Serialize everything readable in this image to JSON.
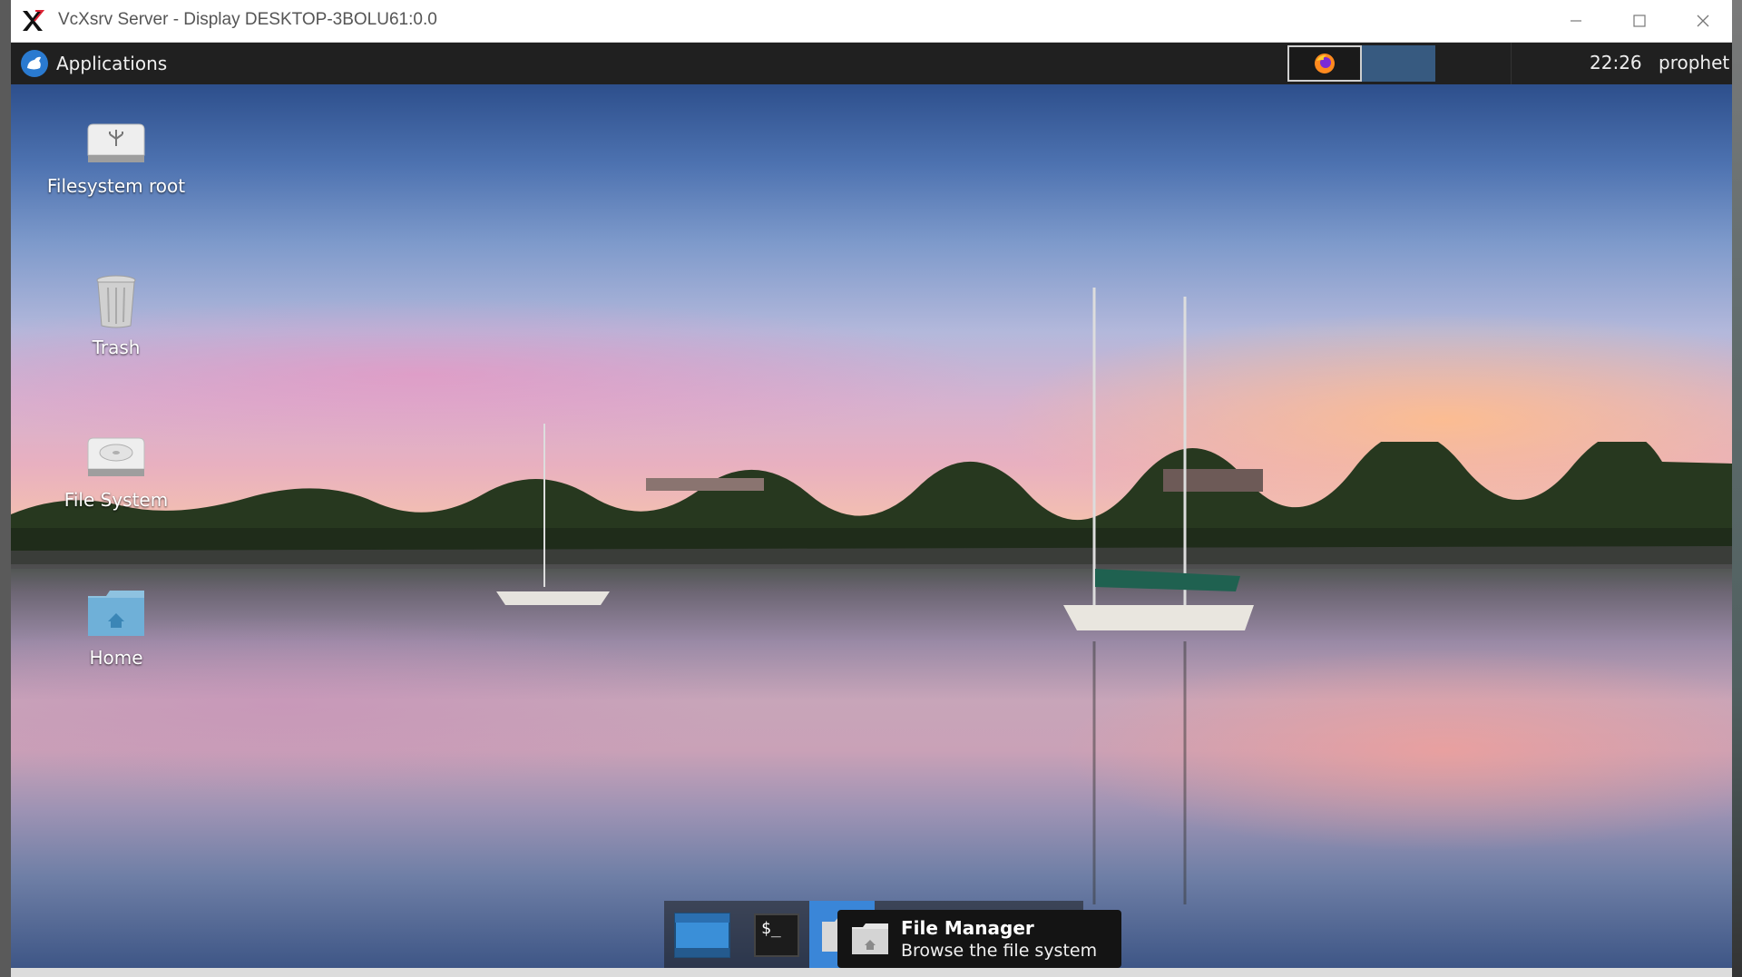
{
  "window": {
    "title": "VcXsrv Server - Display DESKTOP-3BOLU61:0.0"
  },
  "panel": {
    "applications_label": "Applications",
    "clock": "22:26",
    "user": "prophet"
  },
  "desktop": {
    "icons": [
      {
        "label": "Filesystem root",
        "icon": "usb-drive-icon"
      },
      {
        "label": "Trash",
        "icon": "trash-icon"
      },
      {
        "label": "File System",
        "icon": "hard-drive-icon"
      },
      {
        "label": "Home",
        "icon": "home-folder-icon"
      }
    ]
  },
  "dock": {
    "items": [
      "show-desktop-icon",
      "terminal-icon",
      "file-manager-icon"
    ],
    "terminal_glyph": "$_",
    "tooltip": {
      "title": "File Manager",
      "subtitle": "Browse the file system"
    }
  },
  "colors": {
    "panel_bg": "#202020",
    "active_task": "#375a80",
    "dock_active": "#3a86d8"
  }
}
